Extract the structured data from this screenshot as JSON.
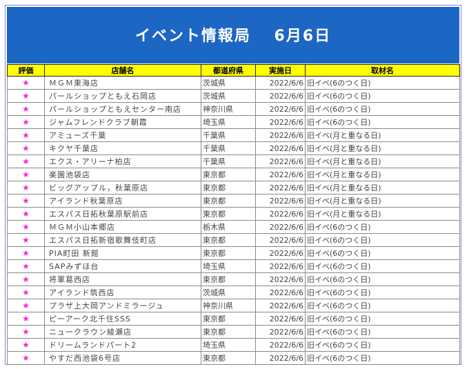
{
  "banner": {
    "title": "イベント情報局　 6月6日"
  },
  "columns": [
    "評価",
    "店舗名",
    "都道府県",
    "実施日",
    "取材名"
  ],
  "rows": [
    {
      "rating": "★",
      "store": "ＭＧＭ東海店",
      "pref": "茨城県",
      "date": "2022/6/6",
      "event": "旧イベ(6のつく日)"
    },
    {
      "rating": "★",
      "store": "パールショップともえ石岡店",
      "pref": "茨城県",
      "date": "2022/6/6",
      "event": "旧イベ(6のつく日)"
    },
    {
      "rating": "★",
      "store": "パールショップともえセンター南店",
      "pref": "神奈川県",
      "date": "2022/6/6",
      "event": "旧イベ(6のつく日)"
    },
    {
      "rating": "★",
      "store": "ジャムフレンドクラブ朝霞",
      "pref": "埼玉県",
      "date": "2022/6/6",
      "event": "旧イベ(6のつく日)"
    },
    {
      "rating": "★",
      "store": "アミューズ千葉",
      "pref": "千葉県",
      "date": "2022/6/6",
      "event": "旧イベ(月と重なる日)"
    },
    {
      "rating": "★",
      "store": "キクヤ千葉店",
      "pref": "千葉県",
      "date": "2022/6/6",
      "event": "旧イベ(月と重なる日)"
    },
    {
      "rating": "★",
      "store": "エクス・アリーナ柏店",
      "pref": "千葉県",
      "date": "2022/6/6",
      "event": "旧イベ(月と重なる日)"
    },
    {
      "rating": "★",
      "store": "楽園池袋店",
      "pref": "東京都",
      "date": "2022/6/6",
      "event": "旧イベ(月と重なる日)"
    },
    {
      "rating": "★",
      "store": "ビッグアップル，秋葉原店",
      "pref": "東京都",
      "date": "2022/6/6",
      "event": "旧イベ(月と重なる日)"
    },
    {
      "rating": "★",
      "store": "アイランド秋葉原店",
      "pref": "東京都",
      "date": "2022/6/6",
      "event": "旧イベ(月と重なる日)"
    },
    {
      "rating": "★",
      "store": "エスパス日拓秋葉原駅前店",
      "pref": "東京都",
      "date": "2022/6/6",
      "event": "旧イベ(月と重なる日)"
    },
    {
      "rating": "★",
      "store": "ＭＧＭ小山本郷店",
      "pref": "栃木県",
      "date": "2022/6/6",
      "event": "旧イベ(6のつく日)"
    },
    {
      "rating": "★",
      "store": "エスパス日拓新宿歌舞伎町店",
      "pref": "東京都",
      "date": "2022/6/6",
      "event": "旧イベ(6のつく日)"
    },
    {
      "rating": "★",
      "store": "PIA町田 新館",
      "pref": "東京都",
      "date": "2022/6/6",
      "event": "旧イベ(6のつく日)"
    },
    {
      "rating": "★",
      "store": "SAPみずほ台",
      "pref": "埼玉県",
      "date": "2022/6/6",
      "event": "旧イベ(6のつく日)"
    },
    {
      "rating": "★",
      "store": "将軍葛西店",
      "pref": "東京都",
      "date": "2022/6/6",
      "event": "旧イベ(6のつく日)"
    },
    {
      "rating": "★",
      "store": "アイランド筑西店",
      "pref": "茨城県",
      "date": "2022/6/6",
      "event": "旧イベ(6のつく日)"
    },
    {
      "rating": "★",
      "store": "プラザ上大岡アンドミラージュ",
      "pref": "神奈川県",
      "date": "2022/6/6",
      "event": "旧イベ(6のつく日)"
    },
    {
      "rating": "★",
      "store": "ピーアーク北千住SSS",
      "pref": "東京都",
      "date": "2022/6/6",
      "event": "旧イベ(6のつく日)"
    },
    {
      "rating": "★",
      "store": "ニュークラウン綾瀬店",
      "pref": "東京都",
      "date": "2022/6/6",
      "event": "旧イベ(6のつく日)"
    },
    {
      "rating": "★",
      "store": "ドリームランドパート2",
      "pref": "埼玉県",
      "date": "2022/6/6",
      "event": "旧イベ(6のつく日)"
    },
    {
      "rating": "★",
      "store": "やすだ西池袋6号店",
      "pref": "東京都",
      "date": "2022/6/6",
      "event": "旧イベ(6のつく日)"
    }
  ]
}
